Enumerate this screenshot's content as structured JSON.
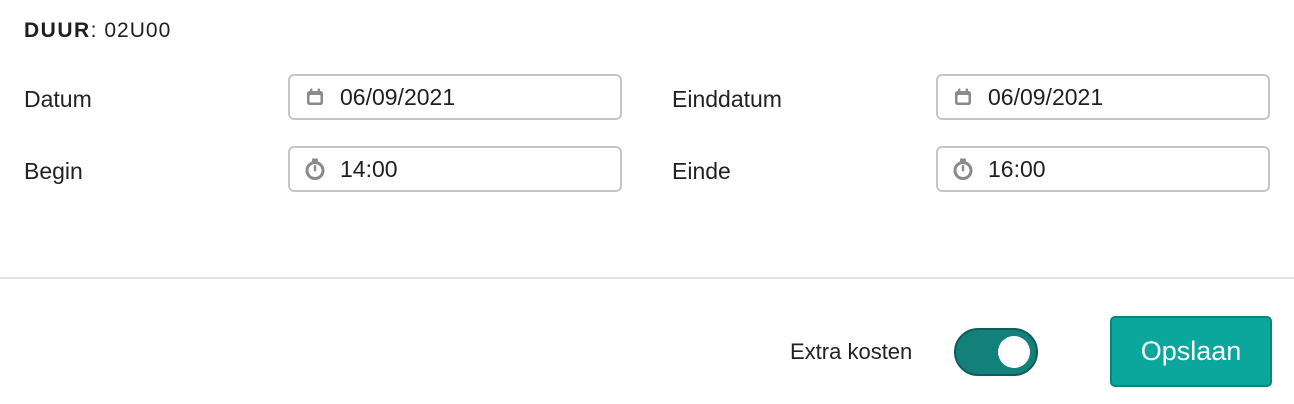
{
  "duration": {
    "label": "DUUR",
    "separator": ":",
    "value": "02U00"
  },
  "fields": {
    "date": {
      "label": "Datum",
      "value": "06/09/2021",
      "icon": "calendar-icon"
    },
    "end_date": {
      "label": "Einddatum",
      "value": "06/09/2021",
      "icon": "calendar-icon"
    },
    "start_time": {
      "label": "Begin",
      "value": "14:00",
      "icon": "clock-icon"
    },
    "end_time": {
      "label": "Einde",
      "value": "16:00",
      "icon": "clock-icon"
    }
  },
  "footer": {
    "extra_costs_label": "Extra kosten",
    "extra_costs_enabled": true,
    "save_label": "Opslaan"
  },
  "colors": {
    "accent": "#0ba79d",
    "toggle_on": "#14807a",
    "input_border": "#c6c6c6",
    "icon": "#8a8a8a",
    "divider": "#e2e2e2"
  }
}
